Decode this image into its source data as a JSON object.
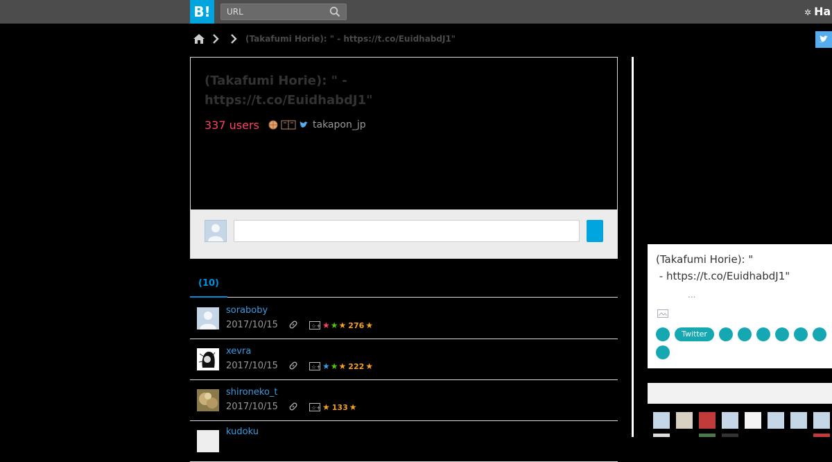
{
  "header": {
    "logo_text": "B!",
    "search_placeholder": "URL",
    "brand_text": "Ha"
  },
  "breadcrumb": {
    "title": "(Takafumi Horie): \"   - https://t.co/EuidhabdJ1\""
  },
  "entry": {
    "title": "(Takafumi Horie): \"   -\nhttps://t.co/EuidhabdJ1\"",
    "users": "337 users",
    "source_user": "takapon_jp"
  },
  "tabs": [
    {
      "label": "(10)"
    }
  ],
  "bookmarks": [
    {
      "user": "soraboby",
      "date": "2017/10/15",
      "count": "276",
      "stars": [
        "#ff4166",
        "#55c500",
        "#f4a024"
      ]
    },
    {
      "user": "xevra",
      "date": "2017/10/15",
      "count": "222",
      "stars": [
        "#3a9be0",
        "#55c500",
        "#f4a024"
      ]
    },
    {
      "user": "shironeko_t",
      "date": "2017/10/15",
      "count": "133",
      "stars": [
        "#f4a024"
      ]
    },
    {
      "user": "kudoku",
      "date": "",
      "count": "",
      "stars": []
    }
  ],
  "sidebar": {
    "title": "(Takafumi Horie): \"\n - https://t.co/EuidhabdJ1\"",
    "ellipsis": "...",
    "tag_label": "Twitter"
  },
  "colors": {
    "accent": "#00a4de",
    "users": "#ff4166",
    "tag": "#15a8b2"
  }
}
